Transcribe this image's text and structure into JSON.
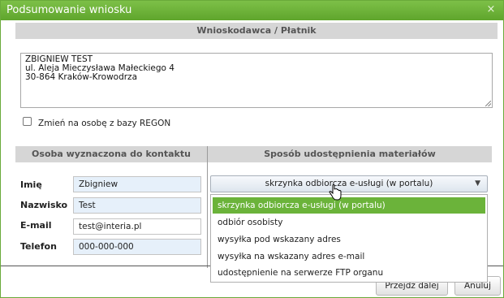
{
  "window": {
    "title": "Podsumowanie wniosku",
    "close_glyph": "×"
  },
  "applicant": {
    "header": "Wnioskodawca / Płatnik",
    "address": "ZBIGNIEW TEST\nul. Aleja Mieczysława Małeckiego 4\n30-864  Kraków-Krowodrza",
    "regon_checkbox_label": "Zmień na osobę z bazy REGON",
    "regon_checked": false
  },
  "contact": {
    "header": "Osoba wyznaczona do kontaktu",
    "fields": [
      {
        "label": "Imię",
        "value": "Zbigniew"
      },
      {
        "label": "Nazwisko",
        "value": "Test"
      },
      {
        "label": "E-mail",
        "value": "test@interia.pl"
      },
      {
        "label": "Telefon",
        "value": "000-000-000"
      }
    ]
  },
  "sharing": {
    "header": "Sposób udostępnienia materiałów",
    "selected": "skrzynka odbiorcza e-usługi (w portalu)",
    "options": [
      "skrzynka odbiorcza e-usługi (w portalu)",
      "odbiór osobisty",
      "wysyłka pod wskazany adres",
      "wysyłka na wskazany adres e-mail",
      "udostępnienie na serwerze FTP organu"
    ]
  },
  "buttons": {
    "next": "Przejdź dalej",
    "cancel": "Anuluj"
  },
  "colors": {
    "titlebar": "#6bb33a",
    "selected_option": "#6bb33a",
    "input_blue": "#e6f0fa",
    "section_header": "#d6d6d6"
  },
  "icons": {
    "close": "close-icon",
    "dropdown": "chevron-down-icon",
    "cursor": "hand-pointer-icon"
  }
}
